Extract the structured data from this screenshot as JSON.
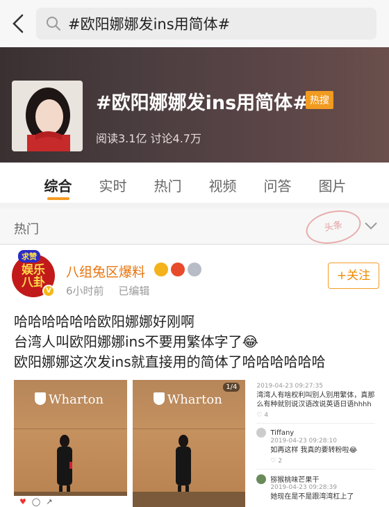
{
  "search": {
    "value": "#欧阳娜娜发ins用简体#"
  },
  "topic": {
    "title": "#欧阳娜娜发ins用简体#",
    "hot_badge": "热搜",
    "stats": "阅读3.1亿  讨论4.7万"
  },
  "tabs": [
    "综合",
    "实时",
    "热门",
    "视频",
    "问答",
    "图片"
  ],
  "section": {
    "label": "热门",
    "stamp": "头条"
  },
  "post": {
    "author": "八组兔区爆料",
    "avatar_text": "娱乐八卦",
    "avatar_tag": "求赞",
    "time": "6小时前",
    "edited": "已编辑",
    "follow": "+关注",
    "lines": [
      "哈哈哈哈哈哈欧阳娜娜好刚啊",
      "台湾人叫欧阳娜娜ins不要用繁体字了😂",
      "欧阳娜娜这次发ins就直接用的简体了哈哈哈哈哈哈"
    ],
    "images": [
      {
        "logo": "Wharton"
      },
      {
        "logo": "Wharton",
        "page": "1/4"
      }
    ],
    "comments": {
      "top_date": "2019-04-23 09:27:35",
      "text1": "湾湾人有啥权利叫别人别用繁体，真那么有种就别说汉语改说英语日语hhhh",
      "count1": "4",
      "user2": "Tiffany",
      "date2": "2019-04-23 09:28:10",
      "text2": "如再这样 我真的要转粉啦😂",
      "count2": "2",
      "user3": "猕猴桃味芒果干",
      "date3": "2019-04-23 09:28:39",
      "text3": "她现在是不是跟湾湾杠上了"
    }
  },
  "colors": {
    "accent": "#f49c23",
    "author": "#e8740c",
    "hot": "#f29b21"
  }
}
